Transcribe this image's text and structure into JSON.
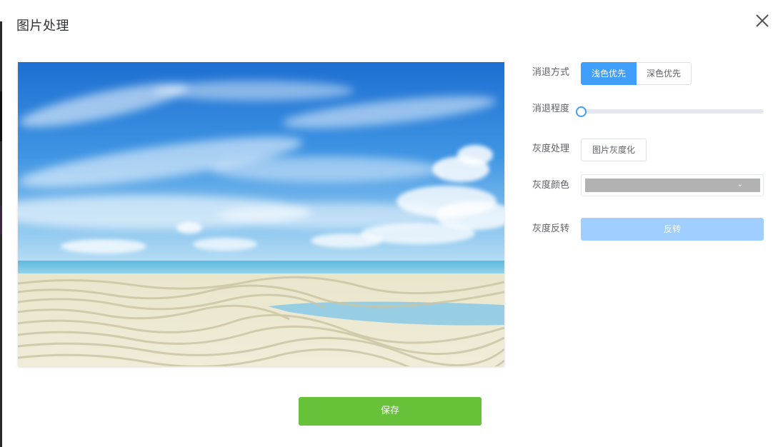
{
  "dialog": {
    "title": "图片处理"
  },
  "controls": {
    "fade_mode": {
      "label": "消退方式",
      "options": [
        "浅色优先",
        "深色优先"
      ],
      "selected": "浅色优先"
    },
    "fade_level": {
      "label": "消退程度",
      "value": 0
    },
    "grayscale": {
      "label": "灰度处理",
      "button_label": "图片灰度化"
    },
    "gray_color": {
      "label": "灰度颜色",
      "value": "#b2b2b2"
    },
    "gray_invert": {
      "label": "灰度反转",
      "button_label": "反转"
    }
  },
  "footer": {
    "save_label": "保存"
  },
  "colors": {
    "primary": "#409eff",
    "primary_disabled": "#a0cfff",
    "success": "#67c23a",
    "gray_swatch": "#b2b2b2"
  },
  "icons": {
    "close": "close-icon",
    "dropdown": "chevron-down-icon"
  }
}
